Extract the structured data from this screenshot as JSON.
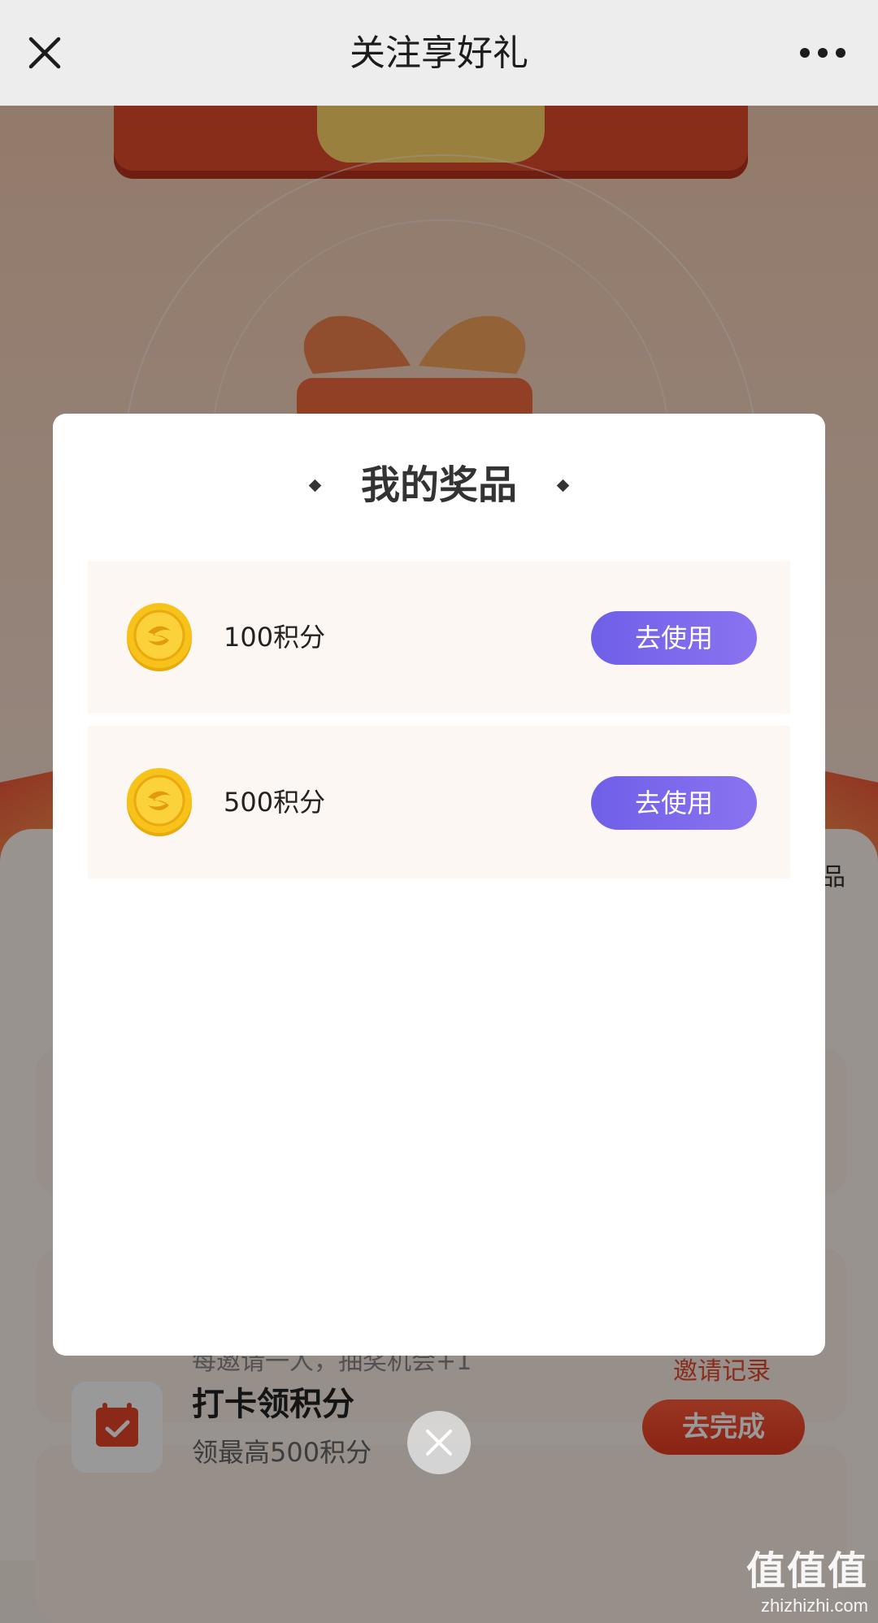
{
  "nav": {
    "title": "关注享好礼"
  },
  "modal": {
    "title": "我的奖品",
    "items": [
      {
        "label": "100积分",
        "button": "去使用"
      },
      {
        "label": "500积分",
        "button": "去使用"
      }
    ]
  },
  "background": {
    "invite_desc": "每邀请一人，抽奖机会+1",
    "invite_record": "邀请记录",
    "prize_peek": "品",
    "task": {
      "title": "打卡领积分",
      "subtitle": "领最高500积分",
      "button": "去完成"
    }
  },
  "watermark": {
    "main": "值值值",
    "domain": "zhizhizhi.com"
  },
  "colors": {
    "accent_purple": "#7766ec",
    "task_red": "#e53b22",
    "coin_gold": "#f7c21a"
  }
}
